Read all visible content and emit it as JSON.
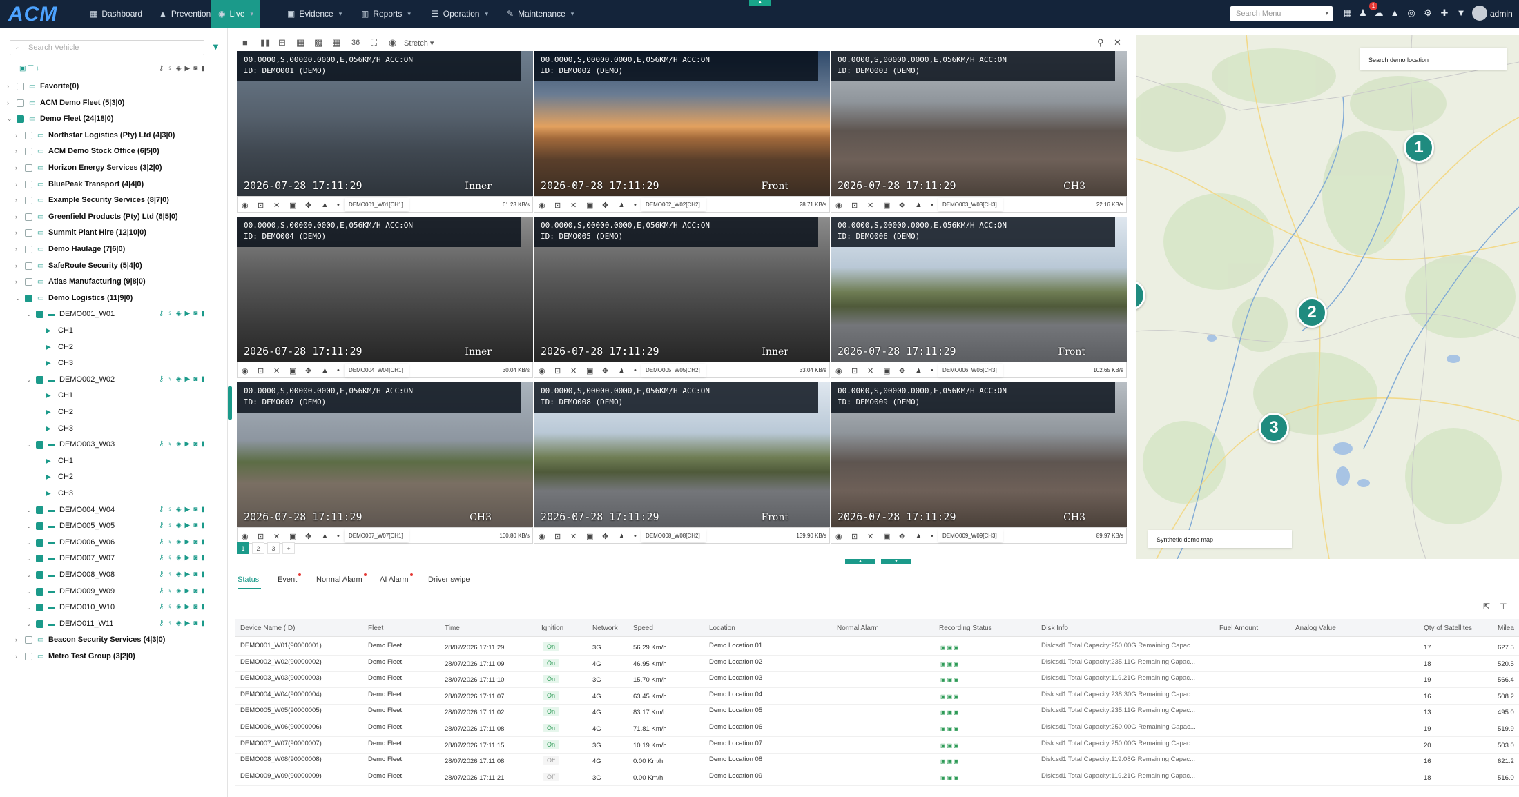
{
  "app": {
    "logo": "ACM",
    "admin": "admin",
    "notif_count": "1",
    "search_menu_placeholder": "Search Menu"
  },
  "nav": [
    {
      "label": "Dashboard",
      "icon": "dashboard-icon"
    },
    {
      "label": "Prevention",
      "icon": "warning-icon"
    },
    {
      "label": "Live",
      "icon": "live-icon"
    },
    {
      "label": "Evidence",
      "icon": "evidence-icon"
    },
    {
      "label": "Reports",
      "icon": "chart-icon"
    },
    {
      "label": "Operation",
      "icon": "operation-icon"
    },
    {
      "label": "Maintenance",
      "icon": "wrench-icon"
    }
  ],
  "sidebar": {
    "search_placeholder": "Search Vehicle",
    "tree": [
      {
        "label": "Favorite(0)",
        "type": "group",
        "level": 0,
        "checked": false
      },
      {
        "label": "ACM Demo Fleet (5|3|0)",
        "type": "fleet",
        "level": 0,
        "checked": false
      },
      {
        "label": "Demo Fleet (24|18|0)",
        "type": "fleet",
        "level": 0,
        "checked": true
      },
      {
        "label": "Northstar Logistics (Pty) Ltd (4|3|0)",
        "type": "fleet",
        "level": 1,
        "checked": false
      },
      {
        "label": "ACM Demo Stock Office (6|5|0)",
        "type": "fleet",
        "level": 1,
        "checked": false
      },
      {
        "label": "Horizon Energy Services (3|2|0)",
        "type": "fleet",
        "level": 1,
        "checked": false
      },
      {
        "label": "BluePeak Transport (4|4|0)",
        "type": "fleet",
        "level": 1,
        "checked": false
      },
      {
        "label": "Example Security Services (8|7|0)",
        "type": "fleet",
        "level": 1,
        "checked": false
      },
      {
        "label": "Greenfield Products (Pty) Ltd (6|5|0)",
        "type": "fleet",
        "level": 1,
        "checked": false
      },
      {
        "label": "Summit Plant Hire (12|10|0)",
        "type": "fleet",
        "level": 1,
        "checked": false
      },
      {
        "label": "Demo Haulage (7|6|0)",
        "type": "fleet",
        "level": 1,
        "checked": false
      },
      {
        "label": "SafeRoute Security (5|4|0)",
        "type": "fleet",
        "level": 1,
        "checked": false
      },
      {
        "label": "Atlas Manufacturing (9|8|0)",
        "type": "fleet",
        "level": 1,
        "checked": false
      },
      {
        "label": "Demo Logistics (11|9|0)",
        "type": "fleet",
        "level": 1,
        "checked": true
      },
      {
        "label": "DEMO001_W01",
        "type": "vehicle",
        "level": 2,
        "checked": true
      },
      {
        "label": "CH1",
        "type": "channel",
        "level": 3
      },
      {
        "label": "CH2",
        "type": "channel",
        "level": 3
      },
      {
        "label": "CH3",
        "type": "channel",
        "level": 3
      },
      {
        "label": "DEMO002_W02",
        "type": "vehicle",
        "level": 2,
        "checked": true
      },
      {
        "label": "CH1",
        "type": "channel",
        "level": 3
      },
      {
        "label": "CH2",
        "type": "channel",
        "level": 3
      },
      {
        "label": "CH3",
        "type": "channel",
        "level": 3
      },
      {
        "label": "DEMO003_W03",
        "type": "vehicle",
        "level": 2,
        "checked": true
      },
      {
        "label": "CH1",
        "type": "channel",
        "level": 3
      },
      {
        "label": "CH2",
        "type": "channel",
        "level": 3
      },
      {
        "label": "CH3",
        "type": "channel",
        "level": 3
      },
      {
        "label": "DEMO004_W04",
        "type": "vehicle",
        "level": 2,
        "checked": true
      },
      {
        "label": "DEMO005_W05",
        "type": "vehicle",
        "level": 2,
        "checked": true
      },
      {
        "label": "DEMO006_W06",
        "type": "vehicle",
        "level": 2,
        "checked": true
      },
      {
        "label": "DEMO007_W07",
        "type": "vehicle",
        "level": 2,
        "checked": true
      },
      {
        "label": "DEMO008_W08",
        "type": "vehicle",
        "level": 2,
        "checked": true
      },
      {
        "label": "DEMO009_W09",
        "type": "vehicle",
        "level": 2,
        "checked": true
      },
      {
        "label": "DEMO010_W10",
        "type": "vehicle",
        "level": 2,
        "checked": true
      },
      {
        "label": "DEMO011_W11",
        "type": "vehicle",
        "level": 2,
        "checked": true
      },
      {
        "label": "Beacon Security Services (4|3|0)",
        "type": "fleet",
        "level": 1,
        "checked": false
      },
      {
        "label": "Metro Test Group (3|2|0)",
        "type": "fleet",
        "level": 1,
        "checked": false
      }
    ]
  },
  "grid": {
    "layout_count": "36",
    "stretch_label": "Stretch",
    "tiles": [
      {
        "hud": "00.0000,S,00000.0000,E,056KM/H ACC:ON\nID: DEMO001 (DEMO)",
        "timestamp": "2026-07-28 17:11:29",
        "cam": "Inner",
        "channel": "DEMO001_W01[CH1]",
        "rate": "61.23 KB/s",
        "scene": "cab"
      },
      {
        "hud": "00.0000,S,00000.0000,E,056KM/H ACC:ON\nID: DEMO002 (DEMO)",
        "timestamp": "2026-07-28 17:11:29",
        "cam": "Front",
        "channel": "DEMO002_W02[CH2]",
        "rate": "28.71 KB/s",
        "scene": "sunset"
      },
      {
        "hud": "00.0000,S,00000.0000,E,056KM/H ACC:ON\nID: DEMO003 (DEMO)",
        "timestamp": "2026-07-28 17:11:29",
        "cam": "CH3",
        "channel": "DEMO003_W03[CH3]",
        "rate": "22.16 KB/s",
        "scene": "side"
      },
      {
        "hud": "00.0000,S,00000.0000,E,056KM/H ACC:ON\nID: DEMO004 (DEMO)",
        "timestamp": "2026-07-28 17:11:29",
        "cam": "Inner",
        "channel": "DEMO004_W04[CH1]",
        "rate": "30.04 KB/s",
        "scene": "cabgray"
      },
      {
        "hud": "00.0000,S,00000.0000,E,056KM/H ACC:ON\nID: DEMO005 (DEMO)",
        "timestamp": "2026-07-28 17:11:29",
        "cam": "Inner",
        "channel": "DEMO005_W05[CH2]",
        "rate": "33.04 KB/s",
        "scene": "cabgray"
      },
      {
        "hud": "00.0000,S,00000.0000,E,056KM/H ACC:ON\nID: DEMO006 (DEMO)",
        "timestamp": "2026-07-28 17:11:29",
        "cam": "Front",
        "channel": "DEMO006_W06[CH3]",
        "rate": "102.65 KB/s",
        "scene": "road"
      },
      {
        "hud": "00.0000,S,00000.0000,E,056KM/H ACC:ON\nID: DEMO007 (DEMO)",
        "timestamp": "2026-07-28 17:11:29",
        "cam": "CH3",
        "channel": "DEMO007_W07[CH1]",
        "rate": "100.80 KB/s",
        "scene": "roadside"
      },
      {
        "hud": "00.0000,S,00000.0000,E,056KM/H ACC:ON\nID: DEMO008 (DEMO)",
        "timestamp": "2026-07-28 17:11:29",
        "cam": "Front",
        "channel": "DEMO008_W08[CH2]",
        "rate": "139.90 KB/s",
        "scene": "road"
      },
      {
        "hud": "00.0000,S,00000.0000,E,056KM/H ACC:ON\nID: DEMO009 (DEMO)",
        "timestamp": "2026-07-28 17:11:29",
        "cam": "CH3",
        "channel": "DEMO009_W09[CH3]",
        "rate": "89.97 KB/s",
        "scene": "side"
      }
    ],
    "pages": [
      "1",
      "2",
      "3",
      "+"
    ]
  },
  "map": {
    "search_placeholder": "Search demo location",
    "caption": "Synthetic demo map",
    "pins": [
      "1",
      "2",
      "3"
    ]
  },
  "bottom": {
    "tabs": [
      {
        "label": "Status",
        "dot": false
      },
      {
        "label": "Event",
        "dot": true
      },
      {
        "label": "Normal Alarm",
        "dot": true
      },
      {
        "label": "AI Alarm",
        "dot": true
      },
      {
        "label": "Driver swipe",
        "dot": false
      }
    ],
    "columns": [
      "Device Name (ID)",
      "Fleet",
      "Time",
      "Ignition",
      "Network",
      "Speed",
      "Location",
      "Normal Alarm",
      "Recording Status",
      "Disk Info",
      "Fuel Amount",
      "Analog Value",
      "Qty of Satellites",
      "Milea"
    ],
    "rows": [
      {
        "device": "DEMO001_W01(90000001)",
        "fleet": "Demo Fleet",
        "time": "28/07/2026 17:11:29",
        "ignition": "On",
        "network": "3G",
        "speed": "56.29 Km/h",
        "location": "Demo Location 01",
        "disk": "Disk:sd1 Total Capacity:250.00G Remaining Capac...",
        "sats": "17",
        "mileage": "627.5"
      },
      {
        "device": "DEMO002_W02(90000002)",
        "fleet": "Demo Fleet",
        "time": "28/07/2026 17:11:09",
        "ignition": "On",
        "network": "4G",
        "speed": "46.95 Km/h",
        "location": "Demo Location 02",
        "disk": "Disk:sd1 Total Capacity:235.11G Remaining Capac...",
        "sats": "18",
        "mileage": "520.5"
      },
      {
        "device": "DEMO003_W03(90000003)",
        "fleet": "Demo Fleet",
        "time": "28/07/2026 17:11:10",
        "ignition": "On",
        "network": "3G",
        "speed": "15.70 Km/h",
        "location": "Demo Location 03",
        "disk": "Disk:sd1 Total Capacity:119.21G Remaining Capac...",
        "sats": "19",
        "mileage": "566.4"
      },
      {
        "device": "DEMO004_W04(90000004)",
        "fleet": "Demo Fleet",
        "time": "28/07/2026 17:11:07",
        "ignition": "On",
        "network": "4G",
        "speed": "63.45 Km/h",
        "location": "Demo Location 04",
        "disk": "Disk:sd1 Total Capacity:238.30G Remaining Capac...",
        "sats": "16",
        "mileage": "508.2"
      },
      {
        "device": "DEMO005_W05(90000005)",
        "fleet": "Demo Fleet",
        "time": "28/07/2026 17:11:02",
        "ignition": "On",
        "network": "4G",
        "speed": "83.17 Km/h",
        "location": "Demo Location 05",
        "disk": "Disk:sd1 Total Capacity:235.11G Remaining Capac...",
        "sats": "13",
        "mileage": "495.0"
      },
      {
        "device": "DEMO006_W06(90000006)",
        "fleet": "Demo Fleet",
        "time": "28/07/2026 17:11:08",
        "ignition": "On",
        "network": "4G",
        "speed": "71.81 Km/h",
        "location": "Demo Location 06",
        "disk": "Disk:sd1 Total Capacity:250.00G Remaining Capac...",
        "sats": "19",
        "mileage": "519.9"
      },
      {
        "device": "DEMO007_W07(90000007)",
        "fleet": "Demo Fleet",
        "time": "28/07/2026 17:11:15",
        "ignition": "On",
        "network": "3G",
        "speed": "10.19 Km/h",
        "location": "Demo Location 07",
        "disk": "Disk:sd1 Total Capacity:250.00G Remaining Capac...",
        "sats": "20",
        "mileage": "503.0"
      },
      {
        "device": "DEMO008_W08(90000008)",
        "fleet": "Demo Fleet",
        "time": "28/07/2026 17:11:08",
        "ignition": "Off",
        "network": "4G",
        "speed": "0.00 Km/h",
        "location": "Demo Location 08",
        "disk": "Disk:sd1 Total Capacity:119.08G Remaining Capac...",
        "sats": "16",
        "mileage": "621.2"
      },
      {
        "device": "DEMO009_W09(90000009)",
        "fleet": "Demo Fleet",
        "time": "28/07/2026 17:11:21",
        "ignition": "Off",
        "network": "3G",
        "speed": "0.00 Km/h",
        "location": "Demo Location 09",
        "disk": "Disk:sd1 Total Capacity:119.21G Remaining Capac...",
        "sats": "18",
        "mileage": "516.0"
      }
    ]
  },
  "colors": {
    "accent": "#1b9a8a",
    "topbar": "#14243a",
    "pin": "#1f8b7f",
    "alert": "#e53935"
  }
}
